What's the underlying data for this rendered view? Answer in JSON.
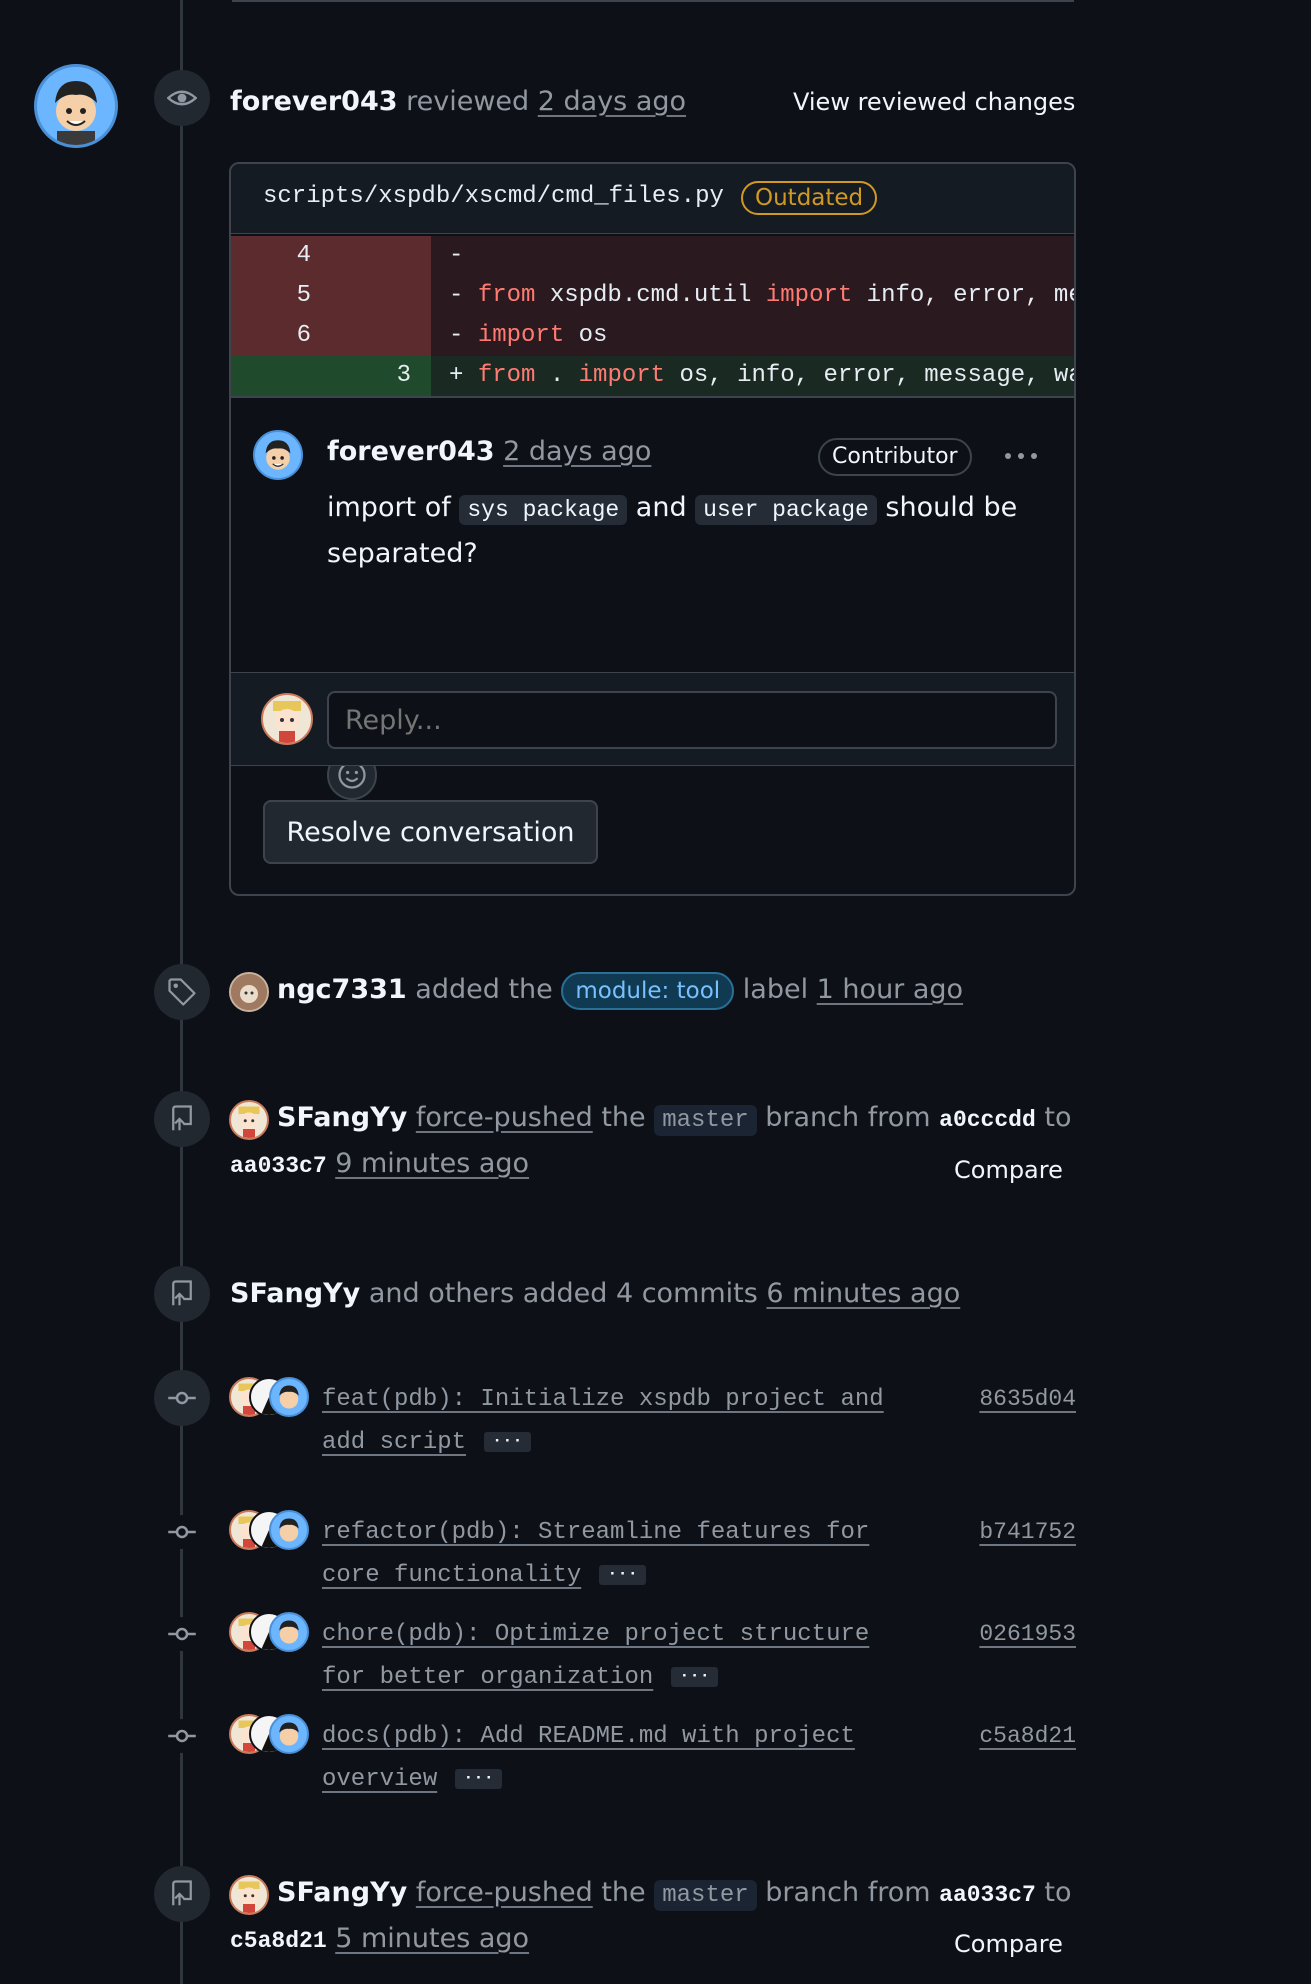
{
  "review": {
    "user": "forever043",
    "action": "reviewed",
    "time": "2 days ago",
    "view_button": "View reviewed changes",
    "file_path": "scripts/xspdb/xscmd/cmd_files.py",
    "status_badge": "Outdated",
    "diff_rows": [
      {
        "type": "del",
        "old": "4",
        "new": "",
        "sign": "-",
        "code": ""
      },
      {
        "type": "del",
        "old": "5",
        "new": "",
        "sign": "-",
        "code": "from xspdb.cmd.util import info, error, me"
      },
      {
        "type": "del",
        "old": "6",
        "new": "",
        "sign": "-",
        "code": "import os"
      },
      {
        "type": "add",
        "old": "",
        "new": "3",
        "sign": "+",
        "code": "from . import os, info, error, message, wa"
      }
    ],
    "comment": {
      "user": "forever043",
      "time": "2 days ago",
      "role_badge": "Contributor",
      "text_1": "import of",
      "code_1": "sys package",
      "text_2": "and",
      "code_2": "user package",
      "text_3": "should be",
      "text_4": "separated?"
    },
    "reply_placeholder": "Reply...",
    "resolve_button": "Resolve conversation"
  },
  "label_event": {
    "user": "ngc7331",
    "text_1": "added the",
    "label": "module: tool",
    "text_2": "label",
    "time": "1 hour ago"
  },
  "push_event_1": {
    "user": "SFangYy",
    "action": "force-pushed",
    "text_1": "the",
    "branch": "master",
    "text_2": "branch from",
    "from_sha": "a0cccdd",
    "text_3": "to",
    "to_sha": "aa033c7",
    "time": "9 minutes ago",
    "compare": "Compare"
  },
  "commits_event": {
    "user": "SFangYy",
    "text": "and others added 4 commits",
    "time": "6 minutes ago",
    "commits": [
      {
        "line1": "feat(pdb): Initialize xspdb project and",
        "line2": "add script",
        "sha": "8635d04"
      },
      {
        "line1": "refactor(pdb): Streamline features for",
        "line2": "core functionality",
        "sha": "b741752"
      },
      {
        "line1": "chore(pdb): Optimize project structure",
        "line2": "for better organization",
        "sha": "0261953"
      },
      {
        "line1": "docs(pdb): Add README.md with project",
        "line2": "overview",
        "sha": "c5a8d21"
      }
    ],
    "more_label": "···"
  },
  "push_event_2": {
    "user": "SFangYy",
    "action": "force-pushed",
    "text_1": "the",
    "branch": "master",
    "text_2": "branch from",
    "from_sha": "aa033c7",
    "text_3": "to",
    "to_sha": "c5a8d21",
    "time": "5 minutes ago",
    "compare": "Compare"
  },
  "colors": {
    "background": "#0d1117",
    "deleted_line": "#5c2b2e",
    "added_line": "#1f4a2b",
    "keyword": "#ff7b72",
    "outdated": "#d29922",
    "label": "#79c0ff"
  },
  "icons": [
    "eye-icon",
    "tag-icon",
    "repo-push-icon",
    "git-commit-icon",
    "smiley-icon",
    "kebab-horizontal-icon"
  ]
}
